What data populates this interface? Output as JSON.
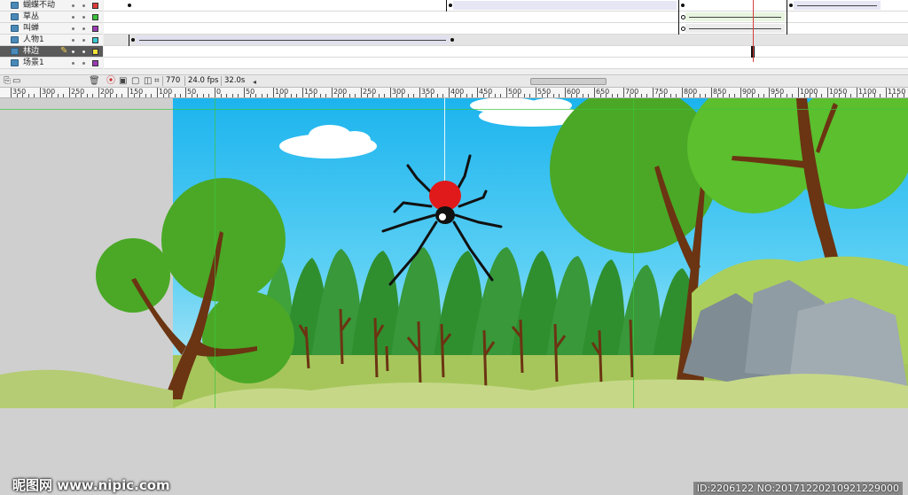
{
  "timeline": {
    "layers": [
      {
        "name": "蝴蝶不动",
        "color": "#e03a3a"
      },
      {
        "name": "草丛",
        "color": "#3ac23a"
      },
      {
        "name": "叫蝉",
        "color": "#9a3ab4"
      },
      {
        "name": "人物1",
        "color": "#3ac8d0"
      },
      {
        "name": "林边",
        "color": "#f2e23a",
        "selected": true
      },
      {
        "name": "场景1",
        "color": "#9a3ab4"
      }
    ]
  },
  "statusbar": {
    "current_frame": "770",
    "fps": "24.0 fps",
    "elapsed": "32.0s"
  },
  "ruler": {
    "labels": [
      "350",
      "300",
      "250",
      "200",
      "150",
      "100",
      "50",
      "0",
      "50",
      "100",
      "150",
      "200",
      "250",
      "300",
      "350",
      "400",
      "450",
      "500",
      "550",
      "600",
      "650",
      "700",
      "750",
      "800",
      "850",
      "900",
      "950",
      "1000",
      "1050",
      "1100",
      "1150"
    ]
  },
  "watermark": {
    "left": "昵图网 www.nipic.com",
    "right": "ID:2206122 NO:20171220210921229000"
  },
  "colors": {
    "sky_top": "#1fb8ee",
    "sky_bottom": "#b9e8f7",
    "tree_dark": "#2c8a2c",
    "tree_light": "#5bbf2e",
    "trunk": "#6b3412",
    "ground": "#a9c75a",
    "rock": "#8e9aa2",
    "spider_red": "#e01a1a"
  }
}
